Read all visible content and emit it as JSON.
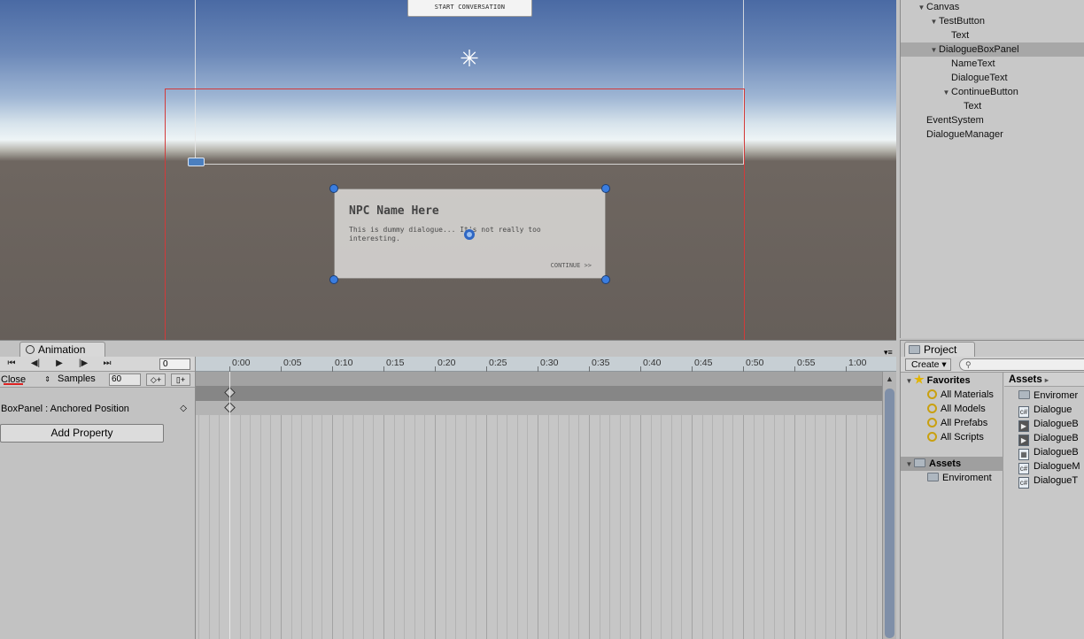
{
  "scene": {
    "start_button": "START CONVERSATION",
    "dialogue_name": "NPC Name Here",
    "dialogue_text": "This is dummy dialogue... It's not really too interesting.",
    "continue_text": "CONTINUE >>"
  },
  "hierarchy": {
    "items": [
      {
        "label": "Canvas",
        "depth": 1,
        "expanded": true
      },
      {
        "label": "TestButton",
        "depth": 2,
        "expanded": true
      },
      {
        "label": "Text",
        "depth": 3
      },
      {
        "label": "DialogueBoxPanel",
        "depth": 2,
        "expanded": true,
        "selected": true
      },
      {
        "label": "NameText",
        "depth": 3
      },
      {
        "label": "DialogueText",
        "depth": 3
      },
      {
        "label": "ContinueButton",
        "depth": 3,
        "expanded": true
      },
      {
        "label": "Text",
        "depth": 4
      },
      {
        "label": "EventSystem",
        "depth": 1
      },
      {
        "label": "DialogueManager",
        "depth": 1
      }
    ]
  },
  "animation": {
    "tab_label": "Animation",
    "frame_value": "0",
    "clip_name": "Close",
    "samples_label": "Samples",
    "samples_value": "60",
    "property_label": "BoxPanel : Anchored Position",
    "add_property_label": "Add Property",
    "timeline_ticks": [
      "0:00",
      "0:05",
      "0:10",
      "0:15",
      "0:20",
      "0:25",
      "0:30",
      "0:35",
      "0:40",
      "0:45",
      "0:50",
      "0:55",
      "1:00"
    ]
  },
  "project": {
    "tab_label": "Project",
    "create_label": "Create",
    "favorites_label": "Favorites",
    "favorites": [
      "All Materials",
      "All Models",
      "All Prefabs",
      "All Scripts"
    ],
    "assets_label": "Assets",
    "asset_folders": [
      "Enviroment"
    ],
    "assets_header": "Assets",
    "asset_files": [
      {
        "name": "Enviromer",
        "icon": "folder-icon"
      },
      {
        "name": "Dialogue",
        "icon": "script-icon"
      },
      {
        "name": "DialogueB",
        "icon": "animation-clip-icon"
      },
      {
        "name": "DialogueB",
        "icon": "animation-clip-icon"
      },
      {
        "name": "DialogueB",
        "icon": "animator-controller-icon"
      },
      {
        "name": "DialogueM",
        "icon": "script-icon"
      },
      {
        "name": "DialogueT",
        "icon": "script-icon"
      }
    ]
  }
}
